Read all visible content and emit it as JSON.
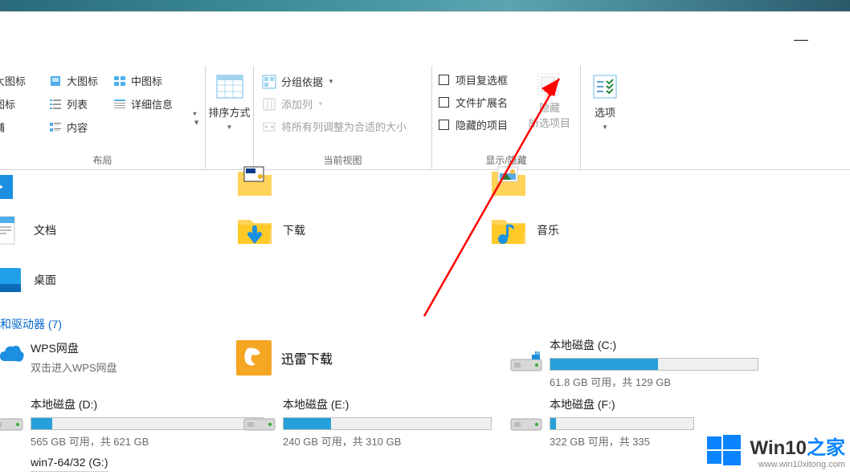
{
  "ribbon": {
    "layout": {
      "group_label": "布局",
      "big_icons": "大图标",
      "large_icons": "大图标",
      "medium_icons": "中图标",
      "small_icons": "图标",
      "list": "列表",
      "details": "详细信息",
      "tiles": "铺",
      "content": "内容"
    },
    "sort": {
      "label": "排序方式"
    },
    "view": {
      "group_label": "当前视图",
      "group_by": "分组依据",
      "add_columns": "添加列",
      "fit_columns": "将所有列调整为合适的大小"
    },
    "show": {
      "group_label": "显示/隐藏",
      "item_checkboxes": "项目复选框",
      "file_extensions": "文件扩展名",
      "hidden_items": "隐藏的项目",
      "hide_selected_l1": "隐藏",
      "hide_selected_l2": "所选项目"
    },
    "options": {
      "label": "选项"
    }
  },
  "folders": {
    "documents": "文档",
    "desktop": "桌面",
    "downloads": "下载",
    "music": "音乐"
  },
  "section": {
    "drives_header": "和驱动器 (7)"
  },
  "wps": {
    "title": "WPS网盘",
    "subtitle": "双击进入WPS网盘"
  },
  "xunlei": {
    "title": "迅雷下载"
  },
  "drives": {
    "c": {
      "title": "本地磁盘 (C:)",
      "info": "61.8 GB 可用，共 129 GB",
      "fill_pct": 52
    },
    "d": {
      "title": "本地磁盘 (D:)",
      "info": "565 GB 可用，共 621 GB",
      "fill_pct": 9
    },
    "e": {
      "title": "本地磁盘 (E:)",
      "info": "240 GB 可用，共 310 GB",
      "fill_pct": 23
    },
    "f": {
      "title": "本地磁盘 (F:)",
      "info": "322 GB 可用，共 335",
      "fill_pct": 4
    },
    "g": {
      "title": "win7-64/32 (G:)"
    }
  },
  "watermark": {
    "brand_prefix": "Win10",
    "brand_suffix": "之家",
    "url": "www.win10xitong.com"
  },
  "colors": {
    "accent": "#26a0da",
    "link": "#0066cc",
    "folder": "#ffd35a",
    "disabled": "#9e9e9e"
  }
}
